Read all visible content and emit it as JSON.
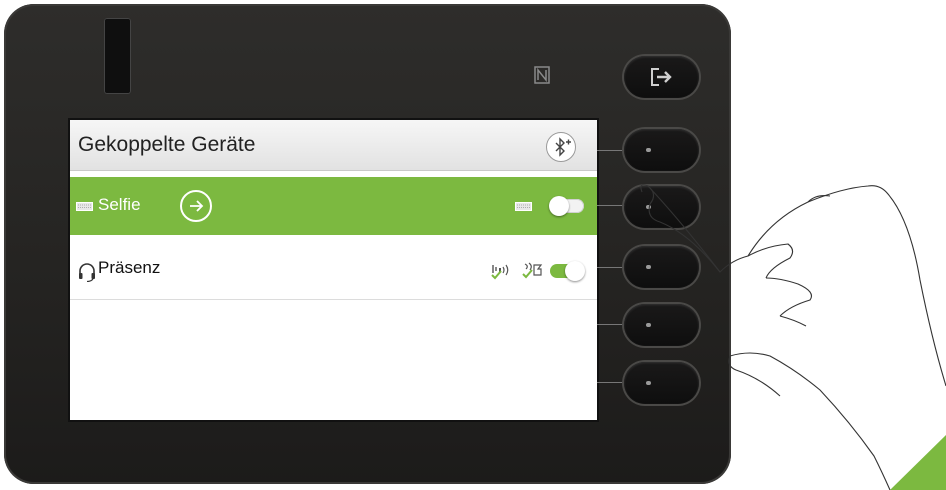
{
  "screen": {
    "title": "Gekoppelte Geräte"
  },
  "devices": [
    {
      "name": "Selfie",
      "enabled": false,
      "selected": true
    },
    {
      "name": "Präsenz",
      "enabled": true,
      "selected": false
    }
  ],
  "icons": {
    "nfc": "nfc-icon",
    "bluetooth_add": "bluetooth-add-icon",
    "keyboard": "keyboard-icon",
    "headset": "headset-icon",
    "arrow": "arrow-right-icon",
    "exit": "exit-icon",
    "audio_check": "audio-check-icon",
    "presence_check": "presence-check-icon"
  },
  "colors": {
    "accent_green": "#7cb940",
    "phone_body": "#262523",
    "title_text": "#222222"
  }
}
